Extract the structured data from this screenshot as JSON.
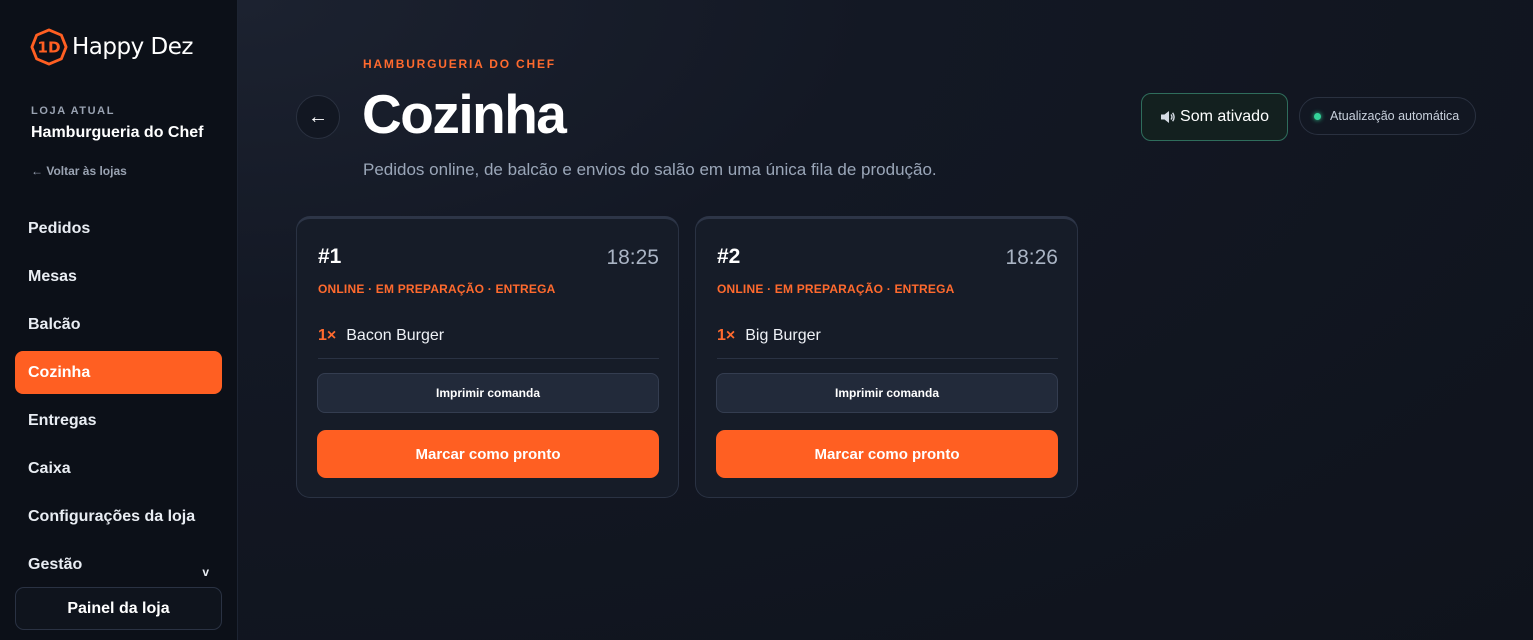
{
  "brand": {
    "name": "Happy Dez",
    "logo_icon": "happy-dez-logo-icon",
    "accent": "#ff5f22"
  },
  "sidebar": {
    "store_label": "LOJA ATUAL",
    "store_name": "Hamburgueria do Chef",
    "back_link": "← Voltar às lojas",
    "items": [
      {
        "label": "Pedidos"
      },
      {
        "label": "Mesas"
      },
      {
        "label": "Balcão"
      },
      {
        "label": "Cozinha",
        "active": true
      },
      {
        "label": "Entregas"
      },
      {
        "label": "Caixa"
      },
      {
        "label": "Configurações da loja"
      },
      {
        "label": "Gestão",
        "chevron": "v"
      }
    ],
    "panel_button": "Painel da loja"
  },
  "header": {
    "eyebrow": "HAMBURGUERIA DO CHEF",
    "back_icon": "←",
    "title": "Cozinha",
    "subtitle": "Pedidos online, de balcão e envios do salão em uma única fila de produção.",
    "sound_button": {
      "icon": "speaker-icon",
      "label": "Som ativado"
    },
    "auto_update": {
      "label": "Atualização automática",
      "status_color": "#34d399"
    }
  },
  "orders": [
    {
      "number": "#1",
      "time": "18:25",
      "status": "ONLINE · EM PREPARAÇÃO · ENTREGA",
      "items": [
        {
          "qty": "1×",
          "name": "Bacon Burger"
        }
      ],
      "print_label": "Imprimir comanda",
      "ready_label": "Marcar como pronto"
    },
    {
      "number": "#2",
      "time": "18:26",
      "status": "ONLINE · EM PREPARAÇÃO · ENTREGA",
      "items": [
        {
          "qty": "1×",
          "name": "Big Burger"
        }
      ],
      "print_label": "Imprimir comanda",
      "ready_label": "Marcar como pronto"
    }
  ]
}
